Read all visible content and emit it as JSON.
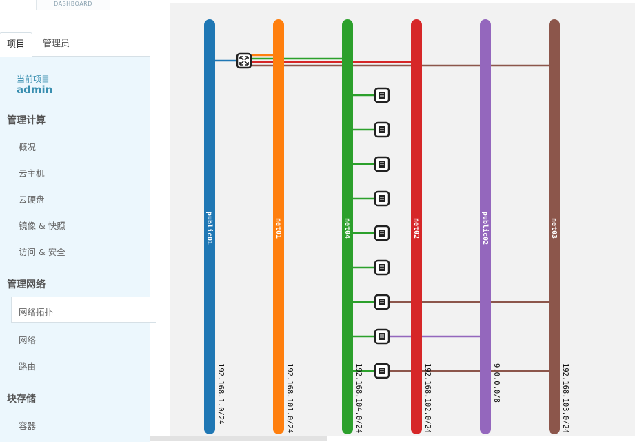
{
  "app": {
    "logo_text": "DASHBOARD"
  },
  "tabs": [
    {
      "label": "项目"
    },
    {
      "label": "管理员"
    }
  ],
  "project": {
    "label": "当前项目",
    "name": "admin"
  },
  "sections": {
    "compute": {
      "title": "管理计算",
      "items": [
        {
          "label": "概况"
        },
        {
          "label": "云主机"
        },
        {
          "label": "云硬盘"
        },
        {
          "label": "镜像 & 快照"
        },
        {
          "label": "访问 & 安全"
        }
      ]
    },
    "network": {
      "title": "管理网络",
      "items": [
        {
          "label": "网络拓扑"
        },
        {
          "label": "网络"
        },
        {
          "label": "路由"
        }
      ]
    },
    "storage": {
      "title": "块存储",
      "items": [
        {
          "label": "容器"
        }
      ]
    }
  },
  "topology": {
    "networks": [
      {
        "name": "public01",
        "cidr": "192.168.1.0/24",
        "color": "#1f77b4"
      },
      {
        "name": "net01",
        "cidr": "192.168.101.0/24",
        "color": "#ff7f0e"
      },
      {
        "name": "net04",
        "cidr": "192.168.104.0/24",
        "color": "#2ca02c"
      },
      {
        "name": "net02",
        "cidr": "192.168.102.0/24",
        "color": "#d62728"
      },
      {
        "name": "public02",
        "cidr": "9.0.0.0/8",
        "color": "#9467bd"
      },
      {
        "name": "net03",
        "cidr": "192.168.103.0/24",
        "color": "#8c564b"
      }
    ],
    "router": {
      "icon": "router-icon",
      "connected_networks": [
        "public01",
        "net01",
        "net04",
        "net02",
        "net03"
      ]
    },
    "instances": [
      {
        "icon": "server-icon",
        "networks": [
          "net04"
        ]
      },
      {
        "icon": "server-icon",
        "networks": [
          "net04"
        ]
      },
      {
        "icon": "server-icon",
        "networks": [
          "net04"
        ]
      },
      {
        "icon": "server-icon",
        "networks": [
          "net04"
        ]
      },
      {
        "icon": "server-icon",
        "networks": [
          "net04"
        ]
      },
      {
        "icon": "server-icon",
        "networks": [
          "net04"
        ]
      },
      {
        "icon": "server-icon",
        "networks": [
          "net04",
          "net03"
        ]
      },
      {
        "icon": "server-icon",
        "networks": [
          "net04",
          "public02"
        ]
      },
      {
        "icon": "server-icon",
        "networks": [
          "net04",
          "net03"
        ]
      }
    ]
  }
}
